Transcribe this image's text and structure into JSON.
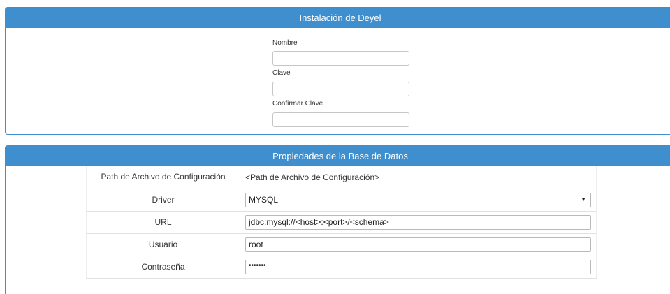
{
  "install_panel": {
    "title": "Instalación de Deyel",
    "fields": {
      "nombre_label": "Nombre",
      "nombre_value": "",
      "clave_label": "Clave",
      "clave_value": "",
      "confirmar_label": "Confirmar Clave",
      "confirmar_value": ""
    }
  },
  "db_panel": {
    "title": "Propiedades de la Base de Datos",
    "rows": {
      "path_label": "Path de Archivo de Configuración",
      "path_value": "<Path de Archivo de Configuración>",
      "driver_label": "Driver",
      "driver_value": "MYSQL",
      "url_label": "URL",
      "url_value": "jdbc:mysql://<host>:<port>/<schema>",
      "usuario_label": "Usuario",
      "usuario_value": "root",
      "password_label": "Contraseña",
      "password_value": "•••••••"
    }
  },
  "icons": {
    "select_caret": "caret-down-icon"
  },
  "colors": {
    "panel_header": "#3f8fce"
  }
}
